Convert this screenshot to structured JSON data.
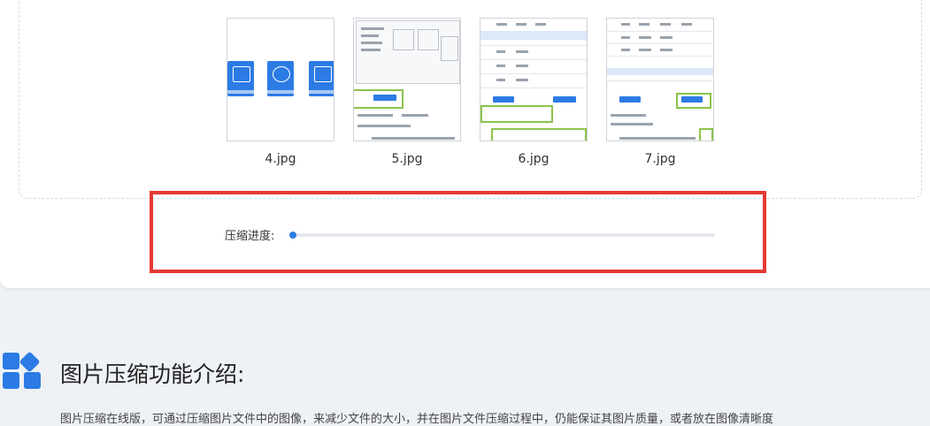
{
  "gallery": {
    "thumbnails": [
      {
        "label": "4.jpg"
      },
      {
        "label": "5.jpg"
      },
      {
        "label": "6.jpg"
      },
      {
        "label": "7.jpg"
      }
    ]
  },
  "progress": {
    "label": "压缩进度:",
    "value_percent": 0,
    "accent": "#2c7be5"
  },
  "section": {
    "icon": "apps-grid-icon",
    "title": "图片压缩功能介绍:",
    "description": "图片压缩在线版，可通过压缩图片文件中的图像，来减少文件的大小，并在图片文件压缩过程中，仍能保证其图片质量，或者放在图像清晰度"
  },
  "colors": {
    "highlight": "#e53935",
    "accent": "#2c7be5"
  }
}
